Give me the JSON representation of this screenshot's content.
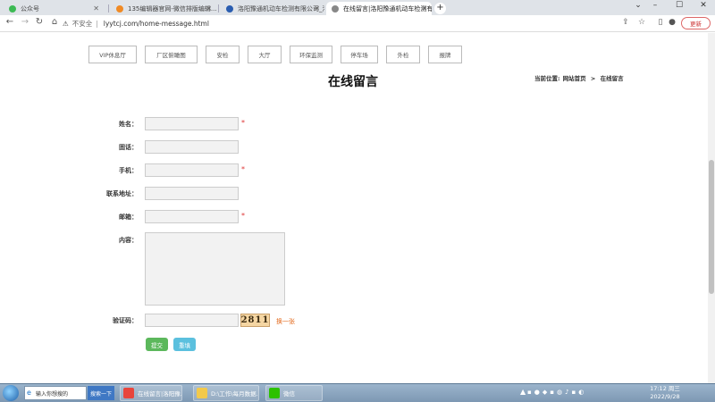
{
  "browser": {
    "tabs": [
      {
        "title": "公众号",
        "active": false
      },
      {
        "title": "135编辑器官网-微信排版编辑...",
        "active": false
      },
      {
        "title": "洛阳豫通机动车检测有限公司_洛...",
        "active": false
      },
      {
        "title": "在线留言|洛阳豫通机动车检测有...",
        "active": true
      }
    ],
    "new_tab": "+",
    "url_warning": "不安全",
    "url": "lyytcj.com/home-message.html",
    "update_button": "更新"
  },
  "site": {
    "nav": [
      "VIP休息厅",
      "厂区俯瞰图",
      "安检",
      "大厅",
      "环保监测",
      "停车场",
      "外检",
      "报牌"
    ],
    "page_title": "在线留言",
    "breadcrumb": {
      "prefix": "当前位置:",
      "home": "网站首页",
      "separator": ">",
      "current": "在线留言"
    }
  },
  "form": {
    "name_label": "姓名：",
    "phone_label": "固话：",
    "mobile_label": "手机：",
    "address_label": "联系地址：",
    "email_label": "邮箱：",
    "content_label": "内容：",
    "captcha_label": "验证码：",
    "required_mark": "*",
    "captcha_text": "2811",
    "swap_captcha": "换一张",
    "submit": "提交",
    "reset": "重填"
  },
  "taskbar": {
    "search_placeholder": "输入你想搜的",
    "search_button": "搜索一下",
    "items": [
      {
        "label": "在线留言|洛阳豫...",
        "color": "#e8453c"
      },
      {
        "label": "D:\\工作\\每月数据...",
        "color": "#f2c94c"
      },
      {
        "label": "微信",
        "color": "#2dc100"
      }
    ],
    "time": "17:12 周三",
    "date": "2022/9/28"
  }
}
